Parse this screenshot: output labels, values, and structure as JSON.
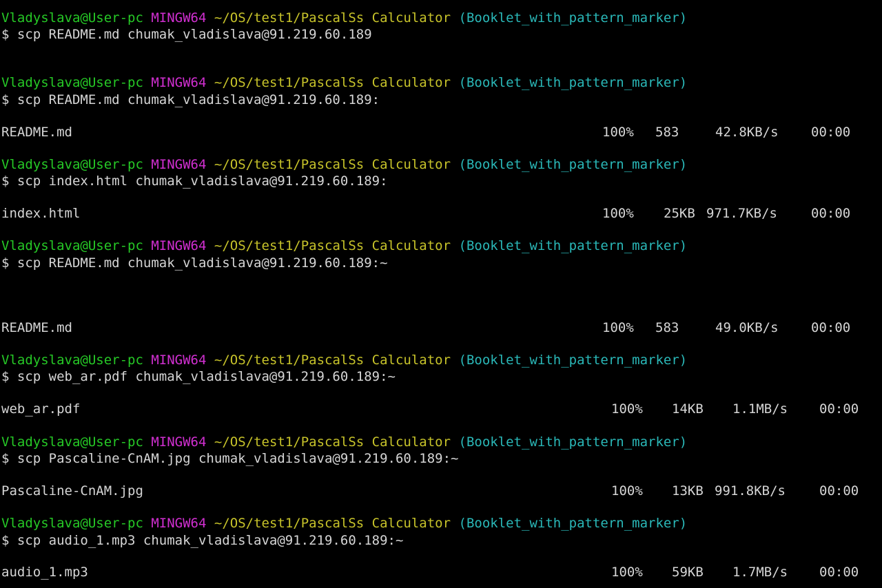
{
  "prompt": {
    "user": "Vladyslava@User-pc",
    "system": "MINGW64",
    "path": "~/OS/test1/PascalSs Calculator",
    "branch": "(Booklet_with_pattern_marker)"
  },
  "entries": [
    {
      "command": "$ scp README.md chumak_vladislava@91.219.60.189"
    },
    {
      "command": "$ scp README.md chumak_vladislava@91.219.60.189:",
      "output": {
        "file": "README.md",
        "percent": "100%",
        "size": "583",
        "rate": "42.8KB/s",
        "time": "00:00"
      }
    },
    {
      "command": "$ scp index.html chumak_vladislava@91.219.60.189:",
      "output": {
        "file": "index.html",
        "percent": "100%",
        "size": "25KB",
        "rate": "971.7KB/s",
        "time": "00:00"
      }
    },
    {
      "command": "$ scp README.md chumak_vladislava@91.219.60.189:~",
      "output": {
        "file": "README.md",
        "percent": "100%",
        "size": "583",
        "rate": "49.0KB/s",
        "time": "00:00"
      }
    },
    {
      "command": "$ scp web_ar.pdf chumak_vladislava@91.219.60.189:~",
      "output": {
        "file": "web_ar.pdf",
        "percent": "100%",
        "size": "14KB",
        "rate": "1.1MB/s",
        "time": "00:00"
      }
    },
    {
      "command": "$ scp Pascaline-CnAM.jpg chumak_vladislava@91.219.60.189:~",
      "output": {
        "file": "Pascaline-CnAM.jpg",
        "percent": "100%",
        "size": "13KB",
        "rate": "991.8KB/s",
        "time": "00:00"
      }
    },
    {
      "command": "$ scp audio_1.mp3 chumak_vladislava@91.219.60.189:~",
      "output": {
        "file": "audio_1.mp3",
        "percent": "100%",
        "size": "59KB",
        "rate": "1.7MB/s",
        "time": "00:00"
      }
    }
  ],
  "colors": {
    "background": "#000000",
    "user": "#26c926",
    "system": "#d12fd1",
    "path": "#c7c32a",
    "branch": "#2ab8b8",
    "text": "#d6d6d6"
  }
}
